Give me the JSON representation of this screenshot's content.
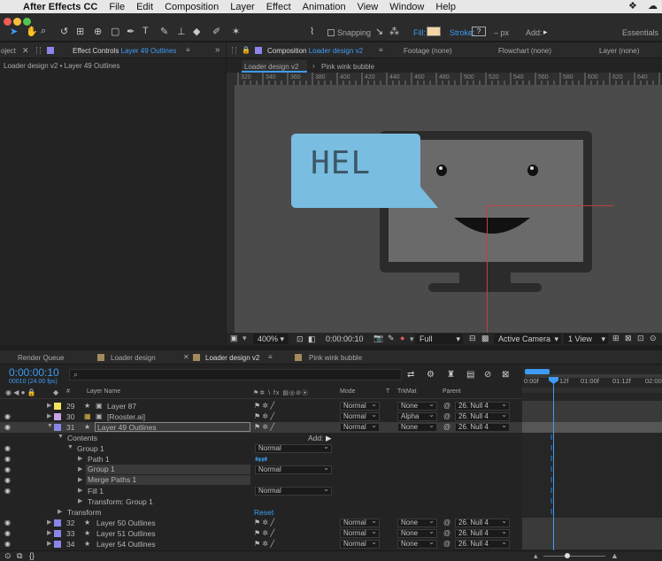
{
  "menubar": {
    "app": "After Effects CC",
    "items": [
      "File",
      "Edit",
      "Composition",
      "Layer",
      "Effect",
      "Animation",
      "View",
      "Window",
      "Help"
    ]
  },
  "toolbar": {
    "snapping": "Snapping",
    "fill": "Fill:",
    "stroke": "Stroke:",
    "stroke_value": "?",
    "px": "– px",
    "add": "Add:",
    "workspace": "Essentials",
    "fill_color": "#f3d6a3"
  },
  "left_panel": {
    "project_tab": "oject",
    "effect_controls": "Effect Controls",
    "effect_controls_layer": "Layer 49 Outlines",
    "breadcrumb": "Loader design v2 • Layer 49 Outlines"
  },
  "comp_panel": {
    "tab_label": "Composition",
    "comp_name": "Loader design v2",
    "footage": "Footage (none)",
    "flowchart": "Flowchart (none)",
    "layer": "Layer (none)",
    "subtabs": [
      "Loader design v2",
      "Pink wink bubble"
    ],
    "ruler_ticks": [
      "320",
      "340",
      "360",
      "380",
      "400",
      "420",
      "440",
      "460",
      "480",
      "500",
      "520",
      "540",
      "560",
      "580",
      "600",
      "620",
      "640"
    ],
    "bubble_text": "HEL",
    "zoom": "400%",
    "timecode": "0:00:00:10",
    "resolution": "Full",
    "camera": "Active Camera",
    "views": "1 View",
    "colors": {
      "bubble": "#79bde0",
      "screen": "#6a6a6a"
    }
  },
  "timeline": {
    "tabs": [
      "Render Queue",
      "Loader design",
      "Loader design v2",
      "Pink wink bubble"
    ],
    "active_tab": "Loader design v2",
    "timecode": "0:00:00:10",
    "fps": "00010 (24.00 fps)",
    "search_placeholder": "",
    "headers": {
      "num": "#",
      "name": "Layer Name",
      "mode": "Mode",
      "t": "T",
      "trkmat": "TrkMat",
      "parent": "Parent"
    },
    "ruler": [
      "0:00f",
      "12f",
      "01:00f",
      "01:12f",
      "02:00"
    ],
    "rows": [
      {
        "num": "29",
        "name": "Layer 87",
        "mode": "Normal",
        "trkmat": "None",
        "parent": "26. Null 4",
        "color": "#f2e35d"
      },
      {
        "num": "30",
        "name": "[Rooster.ai]",
        "mode": "Normal",
        "trkmat": "Alpha",
        "parent": "26. Null 4",
        "color": "#c9a3e6"
      },
      {
        "num": "31",
        "name": "Layer 49 Outlines",
        "mode": "Normal",
        "trkmat": "None",
        "parent": "26. Null 4",
        "color": "#8a86e8"
      }
    ],
    "props": {
      "contents": "Contents",
      "add": "Add:",
      "group1": "Group 1",
      "group1_mode": "Normal",
      "path1": "Path 1",
      "group1_inner": "Group 1",
      "group1_inner_mode": "Normal",
      "merge": "Merge Paths 1",
      "fill1": "Fill 1",
      "fill1_mode": "Normal",
      "transform_group": "Transform: Group 1",
      "transform": "Transform",
      "reset": "Reset"
    },
    "rows2": [
      {
        "num": "32",
        "name": "Layer 50 Outlines",
        "mode": "Normal",
        "trkmat": "None",
        "parent": "26. Null 4",
        "color": "#8a86e8"
      },
      {
        "num": "33",
        "name": "Layer 51 Outlines",
        "mode": "Normal",
        "trkmat": "None",
        "parent": "26. Null 4",
        "color": "#8a86e8"
      },
      {
        "num": "34",
        "name": "Layer 54 Outlines",
        "mode": "Normal",
        "trkmat": "None",
        "parent": "26. Null 4",
        "color": "#8a86e8"
      }
    ]
  }
}
